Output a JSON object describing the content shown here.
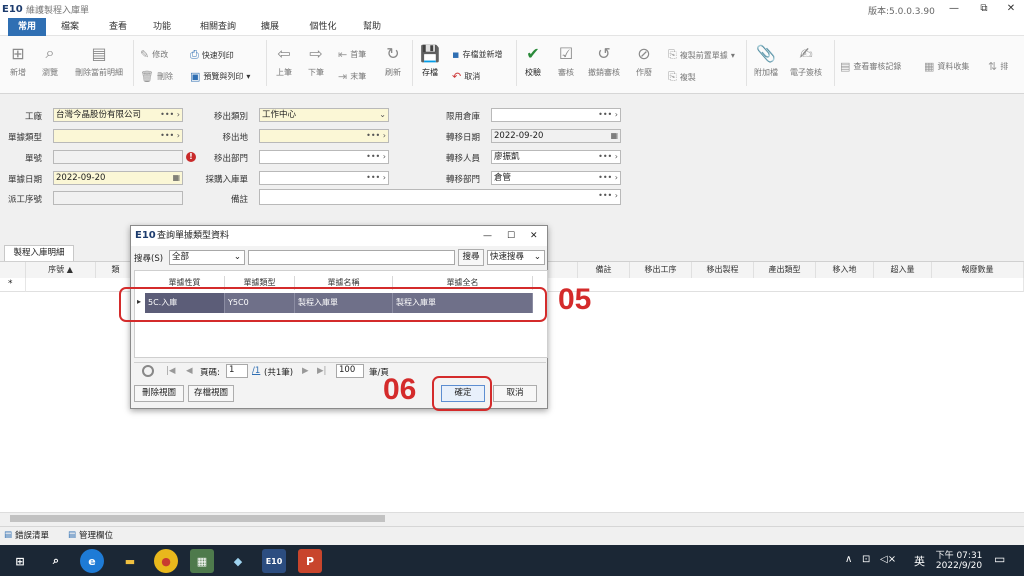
{
  "window": {
    "logo": "E10",
    "title": "維護製程入庫單",
    "version": "版本:5.0.0.3.90",
    "minimize": "—",
    "restore": "⧉",
    "close": "✕"
  },
  "menu": {
    "tabs": [
      "常用",
      "檔案",
      "查看",
      "功能",
      "相關查詢",
      "擴展",
      "個性化",
      "幫助"
    ]
  },
  "ribbon": {
    "new": "新增",
    "browse": "瀏覽",
    "delete_detail": "刪除當前明細",
    "modify": "修改",
    "delete": "刪除",
    "quick_print": "快速列印",
    "preview_print": "預覽與列印",
    "prev": "上筆",
    "next": "下筆",
    "first": "首筆",
    "last": "末筆",
    "refresh": "刷新",
    "save": "存檔",
    "save_new": "存檔並新增",
    "cancel": "取消",
    "verify": "校驗",
    "approve": "審核",
    "unapprove": "撤銷審核",
    "void": "作廢",
    "copy_prev": "複製前置單據",
    "copy": "複製",
    "attach": "附加檔",
    "esign": "電子簽核",
    "view_audit": "查看審核記錄",
    "collect": "資料收集",
    "more": "排"
  },
  "form": {
    "factory_label": "工廠",
    "factory_value": "台灣今晶股份有限公司",
    "doc_type_label": "單據類型",
    "doc_type_value": "",
    "doc_no_label": "單號",
    "doc_no_value": "",
    "doc_date_label": "單據日期",
    "doc_date_value": "2022-09-20",
    "source_seq_label": "派工序號",
    "source_seq_value": "",
    "move_type_label": "移出類別",
    "move_type_value": "工作中心",
    "move_place_label": "移出地",
    "move_place_value": "",
    "move_dept_label": "移出部門",
    "move_dept_value": "",
    "purchase_in_label": "採購入庫單",
    "purchase_in_value": "",
    "remark_label": "備註",
    "remark_value": "",
    "limit_wh_label": "限用倉庫",
    "limit_wh_value": "",
    "transfer_date_label": "轉移日期",
    "transfer_date_value": "2022-09-20",
    "transfer_person_label": "轉移人員",
    "transfer_person_value": "廖振凱",
    "transfer_dept_label": "轉移部門",
    "transfer_dept_value": "倉管",
    "picker_dots": "•••",
    "picker_arrow": "›",
    "dropdown_arrow": "⌄",
    "calendar": "▦",
    "error_icon": "!"
  },
  "subtab": {
    "label": "製程入庫明細"
  },
  "grid": {
    "headers": [
      "序號",
      "類",
      "",
      "",
      "",
      "",
      "",
      "",
      "",
      "",
      "",
      "",
      "備註",
      "移出工序",
      "移出製程",
      "產出類型",
      "移入地",
      "超入量",
      "報廢數量"
    ],
    "new_row_marker": "*",
    "sort_marker": "▲"
  },
  "bottom_tabs": [
    "錯誤清單",
    "管理欄位"
  ],
  "dialog": {
    "logo": "E10",
    "title": "查詢單據類型資料",
    "min": "—",
    "max": "☐",
    "close": "✕",
    "search_label": "搜尋(S)",
    "search_scope": "全部",
    "search_text": "",
    "search_button": "搜尋",
    "quick_search": "快速搜尋",
    "columns": [
      "單據性質",
      "單據類型",
      "單據名稱",
      "單據全名"
    ],
    "rows": [
      {
        "nature": "5C.入庫",
        "type": "Y5C0",
        "name": "製程入庫單",
        "fullname": "製程入庫單"
      }
    ],
    "row_marker": "▸",
    "pager": {
      "page_label": "頁碼:",
      "page": "1",
      "total": "/1",
      "count_text": "(共1筆)",
      "page_size": "100",
      "page_size_label": "筆/頁"
    },
    "delete_view": "刪除視圖",
    "save_view": "存檔視圖",
    "ok": "確定",
    "cancel": "取消"
  },
  "annotations": {
    "step5": "05",
    "step6": "06"
  },
  "taskbar": {
    "lang": "英",
    "time": "下午 07:31",
    "date": "2022/9/20"
  }
}
